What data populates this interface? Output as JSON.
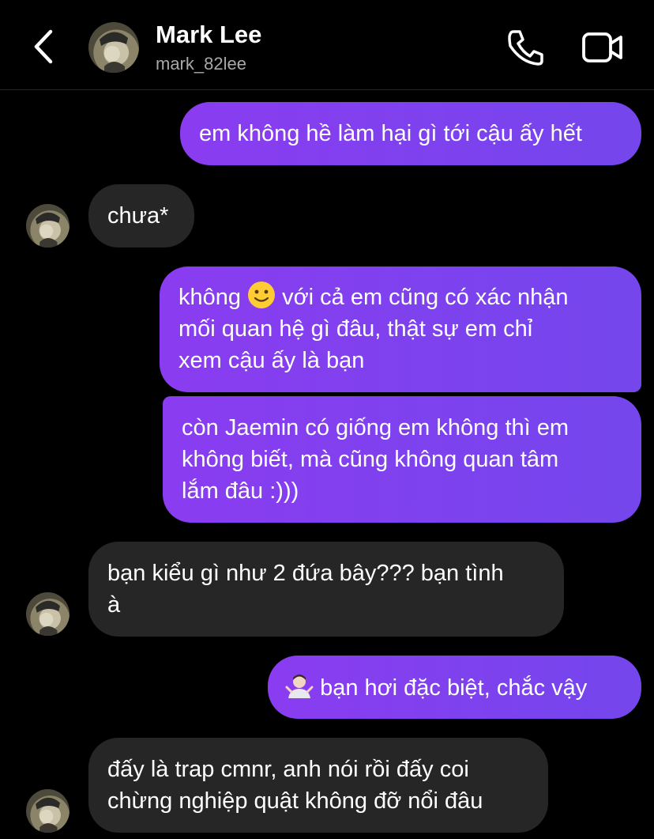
{
  "header": {
    "name": "Mark Lee",
    "username": "mark_82lee"
  },
  "icons": {
    "back": "chevron-left-icon",
    "call": "phone-icon",
    "video": "video-camera-icon",
    "slightly_smiling": "slightly-smiling-face-emoji",
    "shrug": "person-shrugging-emoji"
  },
  "colors": {
    "outgoing_start": "#8a3cf0",
    "outgoing_end": "#7446ec",
    "incoming": "#262626",
    "background": "#000000"
  },
  "messages": [
    {
      "sender": "me",
      "lines": [
        "em không hề làm hại gì tới cậu ấy hết"
      ]
    },
    {
      "sender": "Mark Lee",
      "lines": [
        "chưa*"
      ]
    },
    {
      "sender": "me",
      "lines": [
        "không",
        "với cả em cũng có xác nhận",
        "mối quan hệ gì đâu, thật sự em chỉ",
        "xem cậu ấy là bạn"
      ]
    },
    {
      "sender": "me",
      "lines": [
        "còn Jaemin có giống em không thì em",
        "không biết, mà cũng không quan tâm",
        "lắm đâu :)))"
      ]
    },
    {
      "sender": "Mark Lee",
      "lines": [
        "bạn kiểu gì như 2 đứa bây??? bạn tình",
        "à"
      ]
    },
    {
      "sender": "me",
      "lines": [
        "bạn hơi đặc biệt, chắc vậy"
      ]
    },
    {
      "sender": "Mark Lee",
      "lines": [
        "đấy là trap cmnr, anh nói rồi đấy coi",
        "chừng nghiệp quật không đỡ nổi đâu"
      ]
    }
  ]
}
